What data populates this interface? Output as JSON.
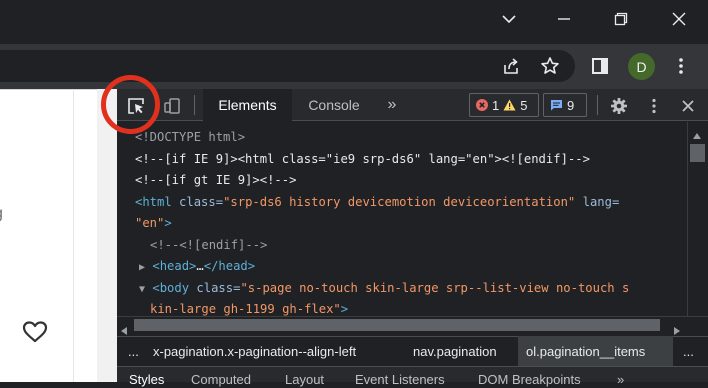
{
  "window": {
    "controls": {
      "tab_list_icon": "chevron-down-icon",
      "minimize_icon": "minimize-icon",
      "restore_icon": "restore-icon",
      "close_icon": "close-icon"
    }
  },
  "toolbar": {
    "share_icon": "share-icon",
    "bookmark_icon": "star-icon",
    "sidepanel_icon": "side-panel-icon",
    "profile_initial": "D",
    "profile_color": "#45692b",
    "menu_icon": "kebab-menu-icon"
  },
  "page": {
    "partial_text": "g",
    "heart_icon": "heart-outline-icon"
  },
  "devtools": {
    "tabs": {
      "elements": "Elements",
      "console": "Console",
      "more": "»"
    },
    "badges": {
      "errors": "1",
      "warnings": "5",
      "messages": "9",
      "error_color": "#e46962",
      "warning_color": "#fdd663",
      "message_color": "#7cacf8"
    },
    "code_lines": {
      "l1": "<!DOCTYPE html>",
      "l2_a": "<!--[if IE 9]><html class=\"ie9 srp-ds6\" lang=\"en\"><![endif]-->",
      "l3": "<!--[if gt IE 9]><!-->",
      "l4_tag": "<html",
      "l4_attr": " class=",
      "l4_val": "\"srp-ds6 history devicemotion deviceorientation\"",
      "l4_attr2": " lang=",
      "l5_val": "\"en\"",
      "l5_tag": ">",
      "l6": "<!--<![endif]-->",
      "l7_tag": "<head>",
      "l7_dots": "…",
      "l7_close": "</head>",
      "l8_tag": "<body",
      "l8_attr": " class=",
      "l8_val": "\"s-page no-touch skin-large srp--list-view no-touch s",
      "l9_val": "kin-large gh-1199 gh-flex\"",
      "l9_tag": ">"
    },
    "breadcrumbs": {
      "ellipsis_left": "...",
      "crumb1": "x-pagination.x-pagination--align-left",
      "crumb2": "nav.pagination",
      "crumb3": "ol.pagination__items",
      "ellipsis_right": "..."
    },
    "bottom_tabs": [
      "Styles",
      "Computed",
      "Layout",
      "Event Listeners",
      "DOM Breakpoints",
      "»"
    ]
  },
  "annotation": {
    "highlight_color": "#e0301e"
  }
}
